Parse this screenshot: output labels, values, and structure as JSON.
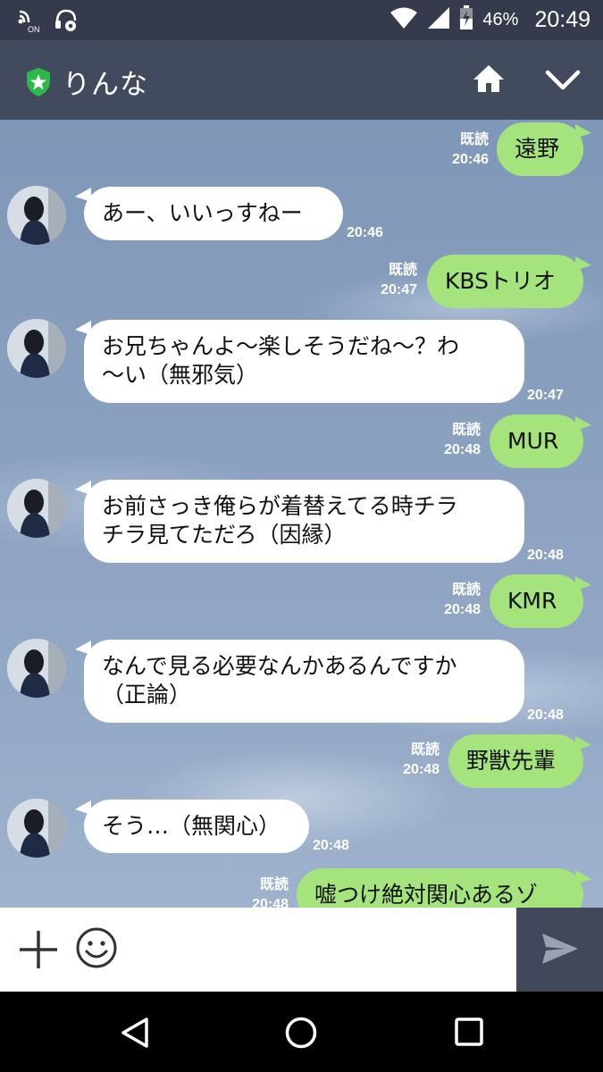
{
  "status_bar": {
    "battery_percent": "46%",
    "time": "20:49",
    "icons": [
      "nfc-on-icon",
      "headset-settings-icon",
      "wifi-icon",
      "cell-signal-icon",
      "battery-icon"
    ]
  },
  "header": {
    "title": "りんな",
    "icons": [
      "official-shield-icon",
      "home-icon",
      "chevron-down-icon"
    ]
  },
  "messages": [
    {
      "side": "out",
      "text": "遠野",
      "read": "既読",
      "time": "20:46"
    },
    {
      "side": "in",
      "text": "あー、いいっすねー",
      "time": "20:46"
    },
    {
      "side": "out",
      "text": "KBSトリオ",
      "read": "既読",
      "time": "20:47"
    },
    {
      "side": "in",
      "lines": [
        "お兄ちゃんよ〜楽しそうだね〜？わ",
        "〜い（無邪気）"
      ],
      "time": "20:47"
    },
    {
      "side": "out",
      "text": "MUR",
      "read": "既読",
      "time": "20:48"
    },
    {
      "side": "in",
      "lines": [
        "お前さっき俺らが着替えてる時チラ",
        "チラ見てただろ（因縁）"
      ],
      "time": "20:48"
    },
    {
      "side": "out",
      "text": "KMR",
      "read": "既読",
      "time": "20:48"
    },
    {
      "side": "in",
      "lines": [
        "なんで見る必要なんかあるんですか",
        "（正論）"
      ],
      "time": "20:48"
    },
    {
      "side": "out",
      "text": "野獣先輩",
      "read": "既読",
      "time": "20:48"
    },
    {
      "side": "in",
      "text": "そう…（無関心）",
      "time": "20:48"
    },
    {
      "side": "out",
      "text": "嘘つけ絶対関心あるゾ",
      "read": "既読",
      "time": "20:48"
    }
  ],
  "input_bar": {
    "icons": [
      "plus-icon",
      "smiley-icon",
      "send-icon"
    ]
  },
  "nav_bar": {
    "icons": [
      "back-icon",
      "home-circle-icon",
      "recents-icon"
    ]
  },
  "colors": {
    "status_bar": "#353b4c",
    "header": "#424a5e",
    "out_bubble": "#a5e37d",
    "in_bubble": "#ffffff",
    "send_box": "#404859"
  }
}
